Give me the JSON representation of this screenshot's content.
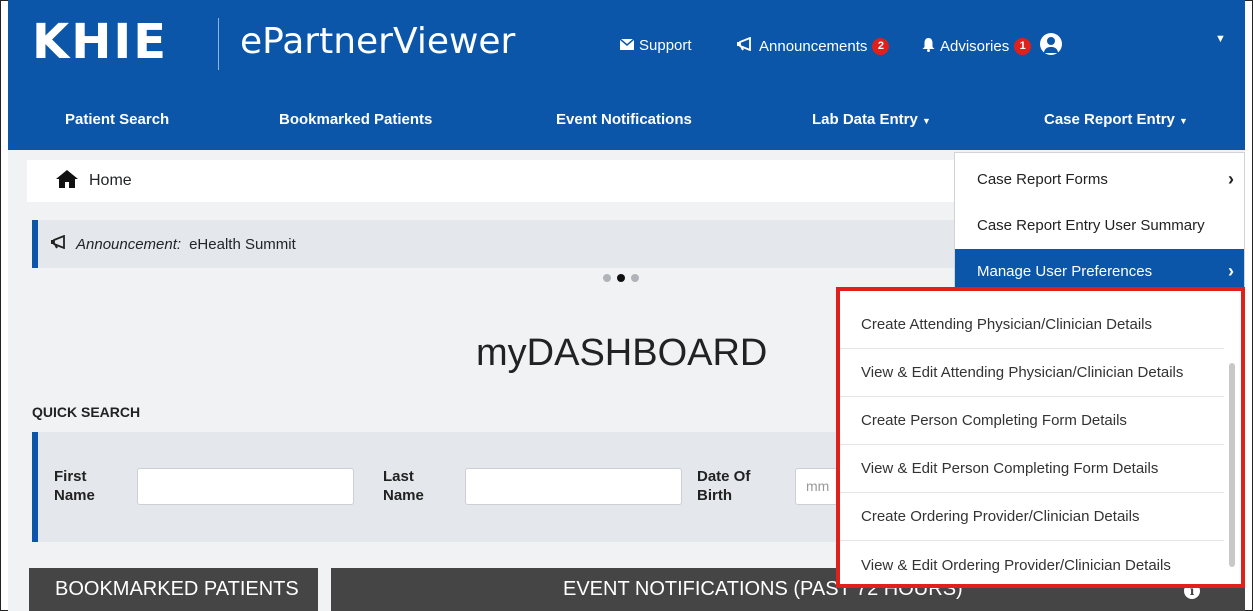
{
  "header": {
    "logo_text": "KHIE",
    "app_name": "ePartnerViewer",
    "support_label": "Support",
    "announcements_label": "Announcements",
    "announcements_count": "2",
    "advisories_label": "Advisories",
    "advisories_count": "1",
    "brand_color": "#0b56a8"
  },
  "nav": {
    "items": [
      {
        "label": "Patient Search"
      },
      {
        "label": "Bookmarked Patients"
      },
      {
        "label": "Event Notifications"
      },
      {
        "label": "Lab Data Entry"
      },
      {
        "label": "Case Report Entry"
      }
    ]
  },
  "breadcrumb": {
    "home_label": "Home"
  },
  "announcement": {
    "prefix": "Announcement:",
    "text": "eHealth Summit"
  },
  "dashboard": {
    "title": "myDASHBOARD"
  },
  "quick_search": {
    "label": "QUICK SEARCH",
    "first_name_label_1": "First",
    "first_name_label_2": "Name",
    "last_name_label_1": "Last",
    "last_name_label_2": "Name",
    "dob_label_1": "Date Of",
    "dob_label_2": "Birth",
    "dob_placeholder": "mm"
  },
  "bottom": {
    "bookmarked_label": "BOOKMARKED PATIENTS",
    "events_label": "EVENT NOTIFICATIONS (PAST 72 HOURS)"
  },
  "dropdown": {
    "items": [
      {
        "label": "Case Report Forms"
      },
      {
        "label": "Case Report Entry User Summary"
      },
      {
        "label": "Manage User Preferences"
      }
    ]
  },
  "submenu": {
    "items": [
      {
        "label": "Create Attending Physician/Clinician Details"
      },
      {
        "label": "View & Edit Attending Physician/Clinician Details"
      },
      {
        "label": "Create Person Completing Form Details"
      },
      {
        "label": "View & Edit Person Completing Form Details"
      },
      {
        "label": "Create Ordering Provider/Clinician Details"
      },
      {
        "label": "View & Edit Ordering Provider/Clinician Details"
      }
    ],
    "highlight_color": "#e0201b"
  }
}
